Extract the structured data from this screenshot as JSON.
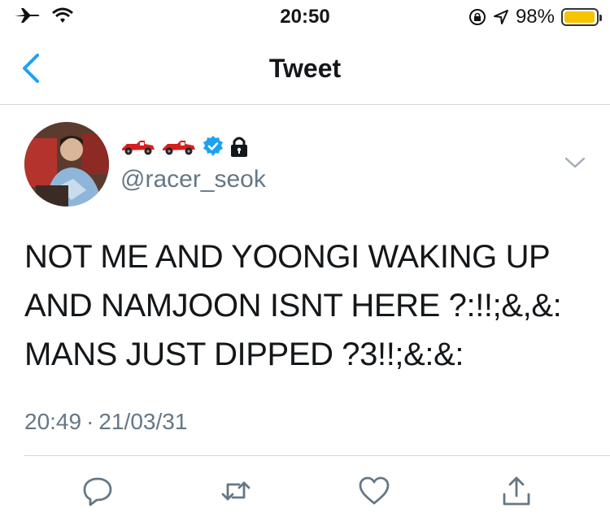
{
  "status_bar": {
    "time": "20:50",
    "battery_percent": "98%",
    "battery_level": 0.98,
    "battery_color": "#f5c300",
    "icons": [
      "airplane-icon",
      "wifi-icon",
      "orientation-lock-icon",
      "location-icon",
      "battery-icon"
    ]
  },
  "nav": {
    "title": "Tweet",
    "back_icon": "chevron-left-icon",
    "accent": "#1da1f2"
  },
  "tweet": {
    "display_name_icons": [
      "race-car-icon",
      "race-car-icon",
      "verified-badge-icon",
      "lock-icon"
    ],
    "handle": "@racer_seok",
    "text": "NOT ME AND YOONGI WAKING UP\nAND NAMJOON ISNT HERE ?:!!;&,&:\nMANS JUST DIPPED ?3!!;&:&:",
    "time": "20:49",
    "separator": "·",
    "date": "21/03/31"
  },
  "actions": {
    "icons": [
      "reply-icon",
      "retweet-icon",
      "like-icon",
      "share-icon"
    ],
    "color": "#657786"
  }
}
